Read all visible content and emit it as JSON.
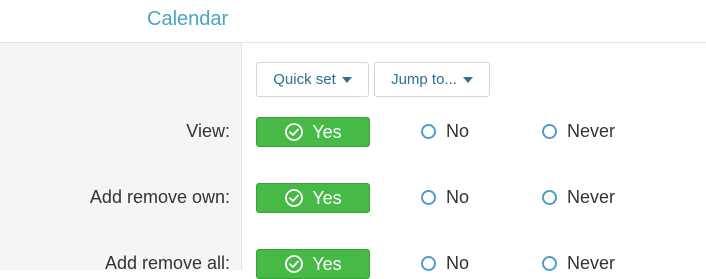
{
  "header": {
    "title": "Calendar"
  },
  "toolbar": {
    "quick_set_label": "Quick set",
    "jump_to_label": "Jump to..."
  },
  "permissions": [
    {
      "label": "View:",
      "yes": "Yes",
      "no": "No",
      "never": "Never",
      "selected": "Yes"
    },
    {
      "label": "Add remove own:",
      "yes": "Yes",
      "no": "No",
      "never": "Never",
      "selected": "Yes"
    },
    {
      "label": "Add remove all:",
      "yes": "Yes",
      "no": "No",
      "never": "Never",
      "selected": "Yes"
    }
  ],
  "colors": {
    "accent": "#4aa3c8",
    "yes_green": "#46b946",
    "radio_border": "#4a9fcc"
  },
  "icons": {
    "yes_icon": "check-circle-icon",
    "caret_icon": "caret-down-icon"
  }
}
